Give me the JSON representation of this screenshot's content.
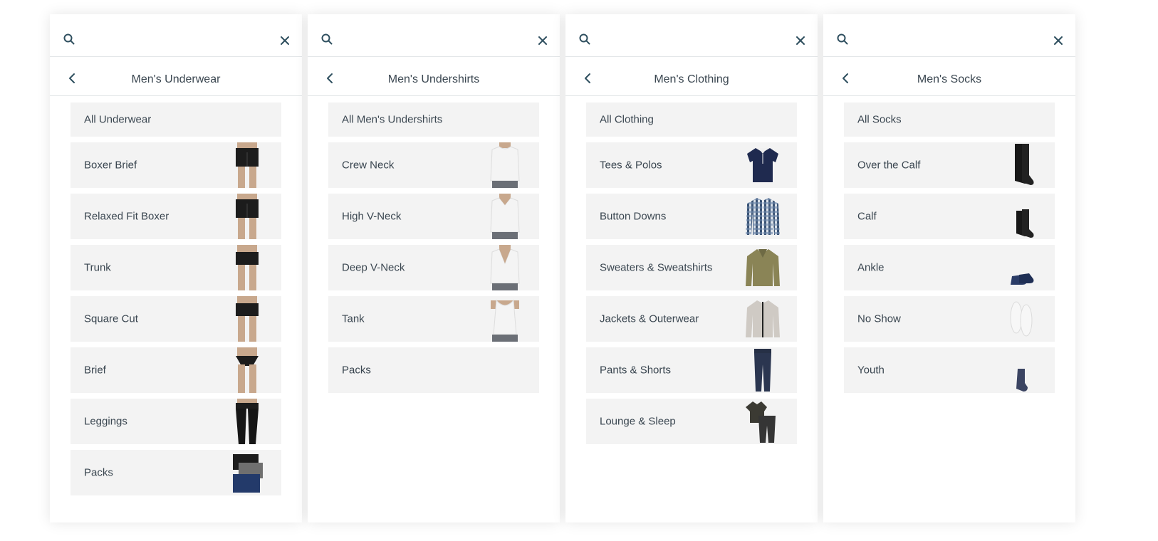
{
  "panels": [
    {
      "title": "Men's Underwear",
      "items": [
        {
          "label": "All Underwear",
          "kind": "all"
        },
        {
          "label": "Boxer Brief",
          "thumb": "boxer-brief"
        },
        {
          "label": "Relaxed Fit Boxer",
          "thumb": "boxer-brief"
        },
        {
          "label": "Trunk",
          "thumb": "trunk"
        },
        {
          "label": "Square Cut",
          "thumb": "trunk"
        },
        {
          "label": "Brief",
          "thumb": "brief"
        },
        {
          "label": "Leggings",
          "thumb": "leggings"
        },
        {
          "label": "Packs",
          "thumb": "underwear-pack"
        }
      ]
    },
    {
      "title": "Men's Undershirts",
      "items": [
        {
          "label": "All Men's Undershirts",
          "kind": "all"
        },
        {
          "label": "Crew Neck",
          "thumb": "crew-tee"
        },
        {
          "label": "High V-Neck",
          "thumb": "vneck-tee"
        },
        {
          "label": "Deep V-Neck",
          "thumb": "deep-vneck-tee"
        },
        {
          "label": "Tank",
          "thumb": "tank"
        },
        {
          "label": "Packs"
        }
      ]
    },
    {
      "title": "Men's Clothing",
      "items": [
        {
          "label": "All Clothing",
          "kind": "all"
        },
        {
          "label": "Tees & Polos",
          "thumb": "polo"
        },
        {
          "label": "Button Downs",
          "thumb": "button-down"
        },
        {
          "label": "Sweaters & Sweatshirts",
          "thumb": "sweater"
        },
        {
          "label": "Jackets & Outerwear",
          "thumb": "jacket"
        },
        {
          "label": "Pants & Shorts",
          "thumb": "pants"
        },
        {
          "label": "Lounge & Sleep",
          "thumb": "lounge-set"
        }
      ]
    },
    {
      "title": "Men's Socks",
      "items": [
        {
          "label": "All Socks",
          "kind": "all"
        },
        {
          "label": "Over the Calf",
          "thumb": "otc-socks"
        },
        {
          "label": "Calf",
          "thumb": "calf-socks"
        },
        {
          "label": "Ankle",
          "thumb": "ankle-socks"
        },
        {
          "label": "No Show",
          "thumb": "no-show-socks"
        },
        {
          "label": "Youth",
          "thumb": "youth-sock"
        }
      ]
    }
  ],
  "colors": {
    "item_bg": "#f3f3f3",
    "text": "#3a4650",
    "icon": "#2f4f5f",
    "navy": "#1f2a4f",
    "olive": "#8a8456",
    "stone": "#cfcac4"
  }
}
